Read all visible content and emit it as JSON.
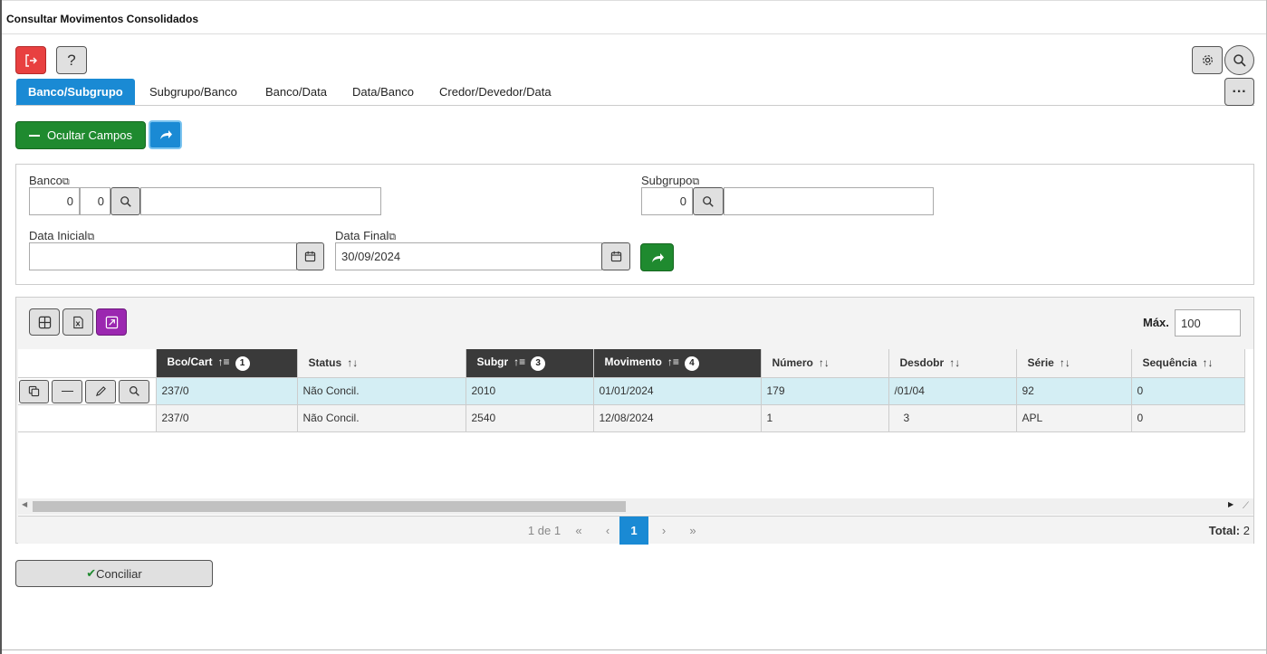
{
  "window": {
    "title": "Consultar Movimentos Consolidados"
  },
  "toolbar": {
    "exit_icon": "exit-icon",
    "help_label": "?"
  },
  "tabs": [
    {
      "label": "Banco/Subgrupo",
      "active": true
    },
    {
      "label": "Subgrupo/Banco"
    },
    {
      "label": "Banco/Data"
    },
    {
      "label": "Data/Banco"
    },
    {
      "label": "Credor/Devedor/Data"
    }
  ],
  "actions": {
    "hide_fields_label": "Ocultar Campos"
  },
  "filters": {
    "banco_label": "Banco",
    "banco_code1": "0",
    "banco_code2": "0",
    "banco_name": "",
    "subgrupo_label": "Subgrupo",
    "subgrupo_code": "0",
    "subgrupo_name": "",
    "data_inicial_label": "Data Inicial",
    "data_inicial_value": "",
    "data_final_label": "Data Final",
    "data_final_value": "30/09/2024"
  },
  "grid": {
    "max_label": "Máx.",
    "max_value": "100",
    "columns": [
      {
        "label": "Bco/Cart",
        "sorted": true,
        "order": "1"
      },
      {
        "label": "Status"
      },
      {
        "label": "Subgr",
        "sorted": true,
        "order": "3"
      },
      {
        "label": "Movimento",
        "sorted": true,
        "order": "4"
      },
      {
        "label": "Número"
      },
      {
        "label": "Desdobr"
      },
      {
        "label": "Série"
      },
      {
        "label": "Sequência"
      }
    ],
    "rows": [
      [
        "237/0",
        "Não Concil.",
        "2010",
        "01/01/2024",
        "179",
        "/01/04",
        "92",
        "0"
      ],
      [
        "237/0",
        "Não Concil.",
        "2540",
        "12/08/2024",
        "1",
        "   3",
        "APL",
        "0"
      ]
    ],
    "pager": {
      "info": "1 de 1",
      "current_page": "1",
      "total_label": "Total:",
      "total_value": "2"
    }
  },
  "footer": {
    "conciliar_label": "Conciliar"
  },
  "colors": {
    "primary": "#1a8ad4",
    "success": "#1f8a2f",
    "danger": "#e84040",
    "accent": "#9b27b0",
    "header_dark": "#3a3a3a"
  }
}
